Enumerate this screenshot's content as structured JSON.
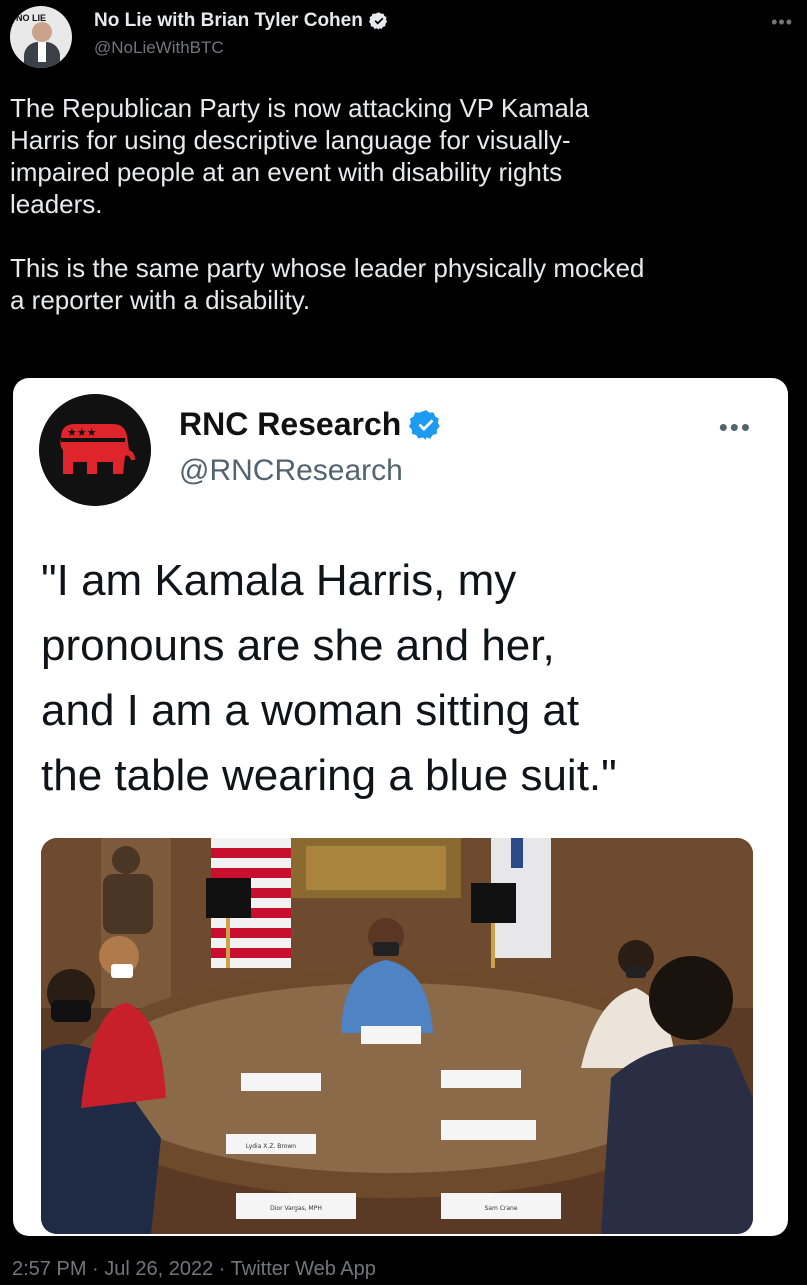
{
  "author": {
    "display_name": "No Lie with Brian Tyler Cohen",
    "handle": "@NoLieWithBTC",
    "avatar_text": "NO LIE",
    "verified_icon": "verified-badge-icon"
  },
  "tweet": {
    "paragraphs": [
      "The Republican Party is now attacking VP Kamala\nHarris for using descriptive language for visually-\nimpaired people at an event with disability rights\nleaders.",
      "This is the same party whose leader physically mocked\na reporter with a disability."
    ],
    "more_icon": "more-options-icon"
  },
  "embedded_card": {
    "display_name": "RNC Research",
    "handle": "@RNCResearch",
    "quote": "\"I am Kamala Harris, my\npronouns are she and her,\nand I am a woman sitting at\nthe table wearing a blue suit.\"",
    "photo_name_cards": [
      "Lydia X.Z. Brown",
      "Dior Vargas, MPH",
      "Sam Crane"
    ],
    "colors": {
      "rnc_red": "#e0242b",
      "verified_blue": "#1d9bf0"
    }
  },
  "footer": {
    "meta": "2:57 PM · Jul 26, 2022 · Twitter Web App"
  }
}
